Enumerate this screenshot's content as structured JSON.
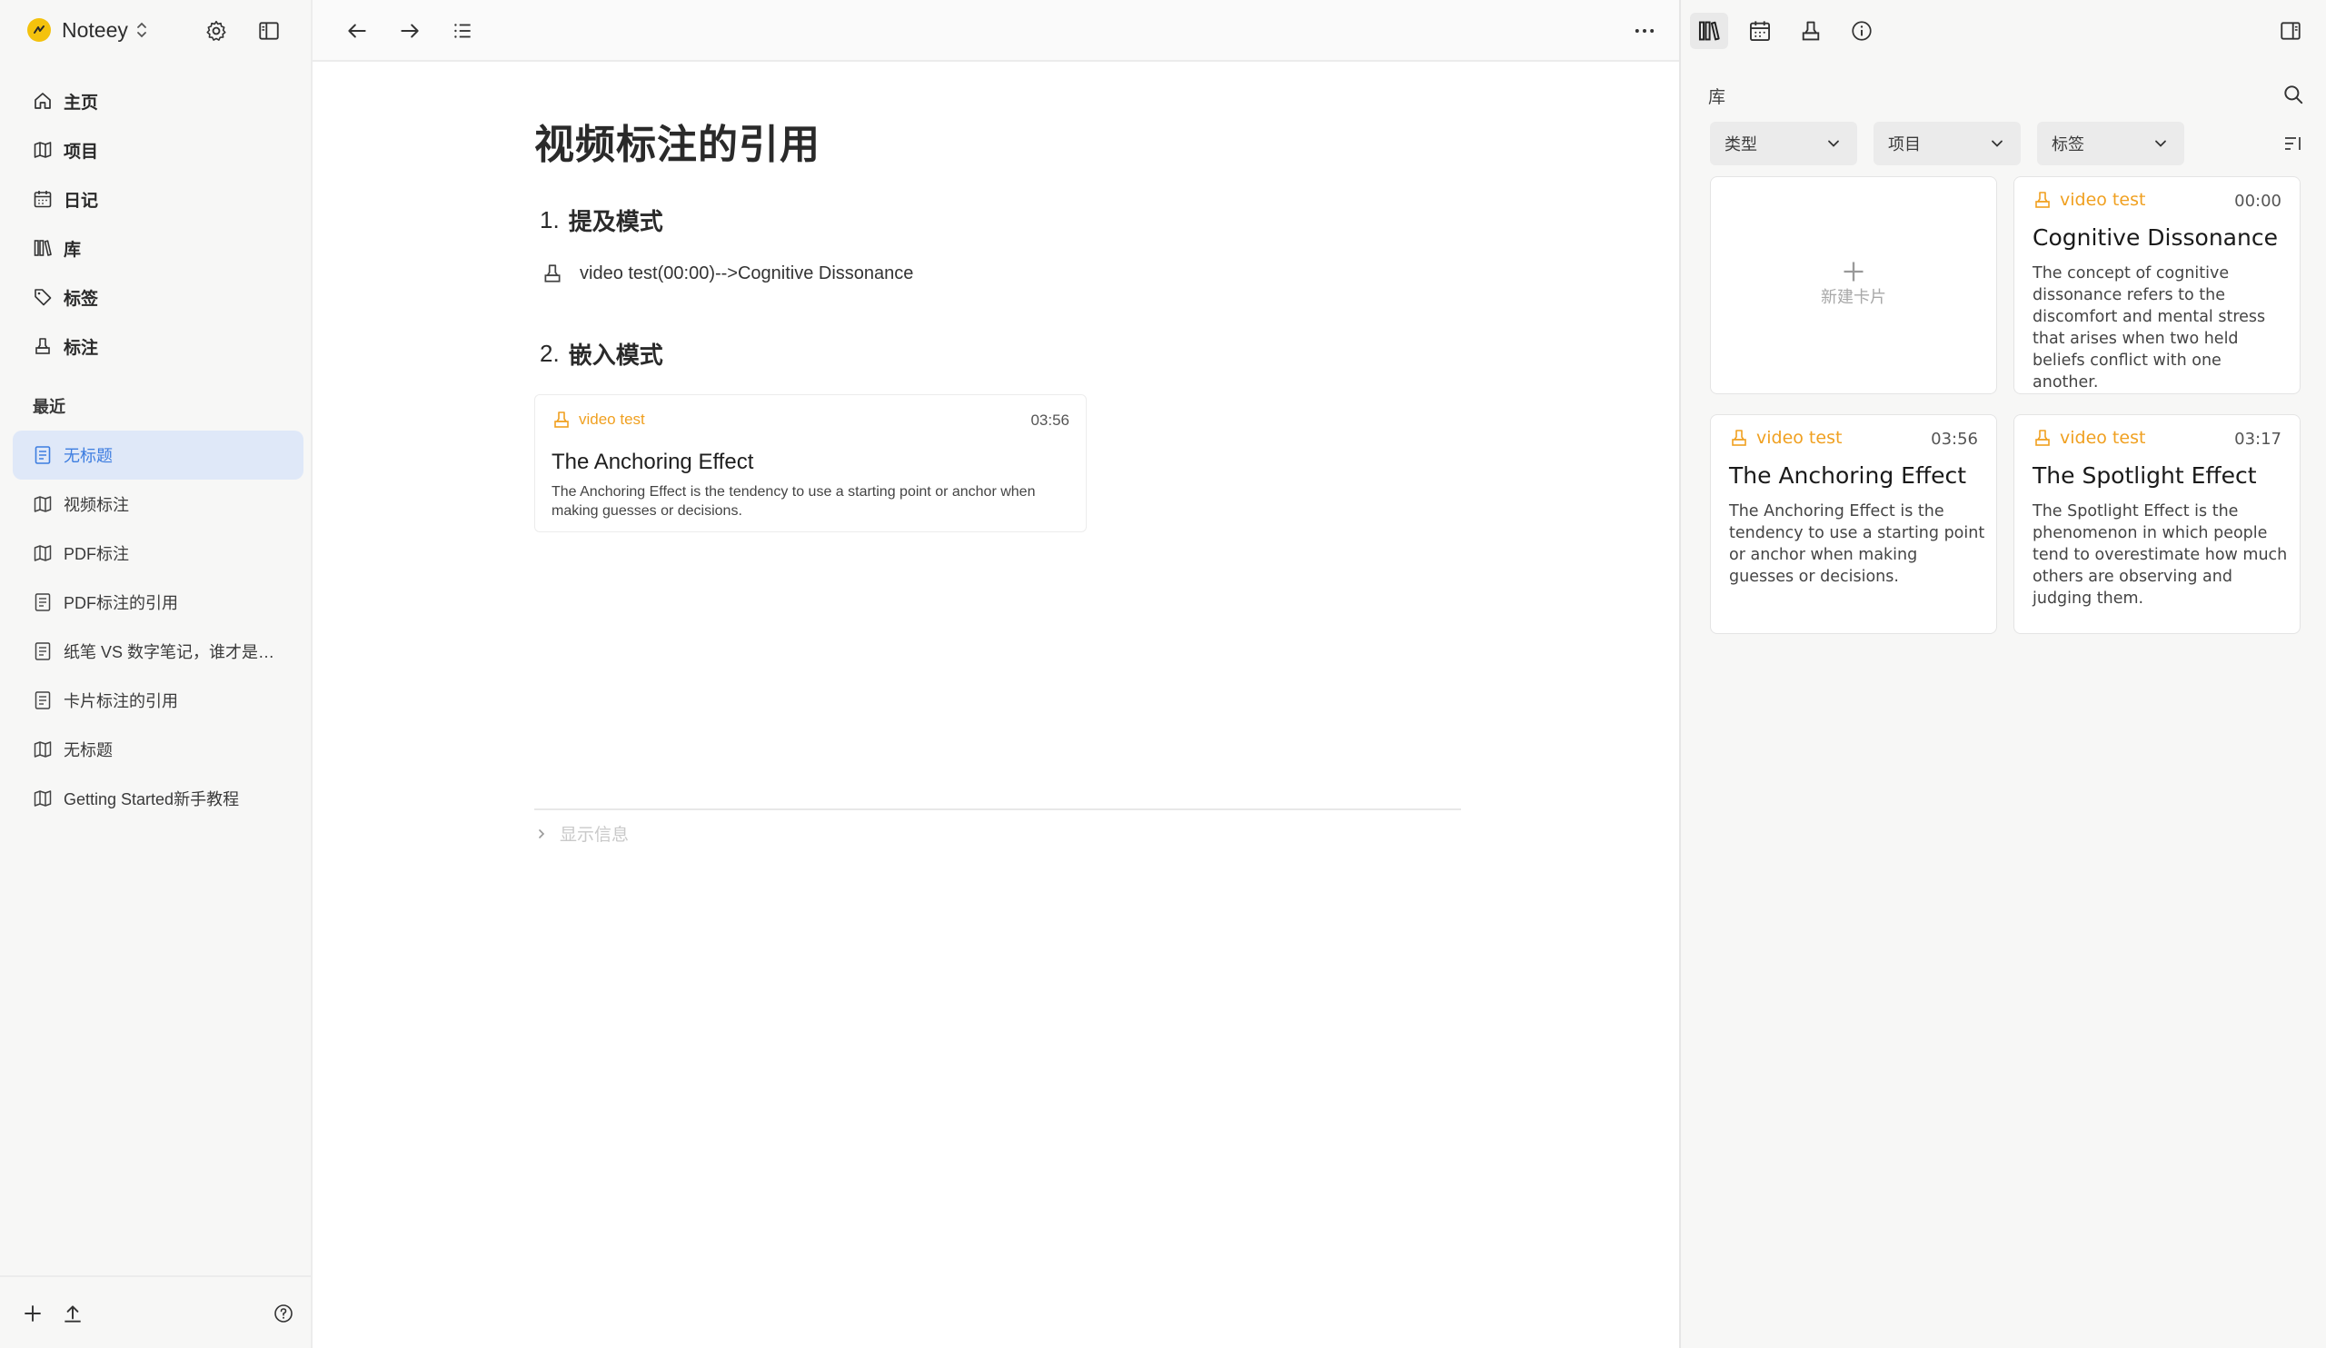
{
  "app": {
    "name": "Noteey"
  },
  "sidebar": {
    "nav": [
      {
        "label": "主页",
        "icon": "home-icon"
      },
      {
        "label": "项目",
        "icon": "map-icon"
      },
      {
        "label": "日记",
        "icon": "calendar-icon"
      },
      {
        "label": "库",
        "icon": "library-icon"
      },
      {
        "label": "标签",
        "icon": "tag-icon"
      },
      {
        "label": "标注",
        "icon": "highlighter-icon"
      }
    ],
    "recent_label": "最近",
    "recent": [
      {
        "label": "无标题",
        "icon": "document-icon",
        "active": true
      },
      {
        "label": "视频标注",
        "icon": "map-icon"
      },
      {
        "label": "PDF标注",
        "icon": "map-icon"
      },
      {
        "label": "PDF标注的引用",
        "icon": "document-icon"
      },
      {
        "label": "纸笔 VS 数字笔记，谁才是最佳选择",
        "icon": "document-icon"
      },
      {
        "label": "卡片标注的引用",
        "icon": "document-icon"
      },
      {
        "label": "无标题",
        "icon": "map-icon"
      },
      {
        "label": "Getting Started新手教程",
        "icon": "map-icon"
      }
    ]
  },
  "document": {
    "title": "视频标注的引用",
    "sections": [
      {
        "number": "1.",
        "heading": "提及模式"
      },
      {
        "number": "2.",
        "heading": "嵌入模式"
      }
    ],
    "mention": {
      "text": "video test(00:00)-->Cognitive Dissonance"
    },
    "embed_card": {
      "source": "video test",
      "time": "03:56",
      "title": "The Anchoring Effect",
      "body": "The Anchoring Effect is the tendency to use a starting point or anchor when making guesses or decisions."
    },
    "show_info": "显示信息"
  },
  "right_panel": {
    "section_title": "库",
    "filters": [
      {
        "label": "类型"
      },
      {
        "label": "项目"
      },
      {
        "label": "标签"
      }
    ],
    "new_card_label": "新建卡片",
    "cards": [
      {
        "source": "video test",
        "time": "00:00",
        "title": "Cognitive Dissonance",
        "body": "The concept of cognitive dissonance refers to the discomfort and mental stress that arises when two held beliefs conflict with one another."
      },
      {
        "source": "video test",
        "time": "03:56",
        "title": "The Anchoring Effect",
        "body": "The Anchoring Effect is the tendency to use a starting point or anchor when making guesses or decisions."
      },
      {
        "source": "video test",
        "time": "03:17",
        "title": "The Spotlight Effect",
        "body": "The Spotlight Effect is the phenomenon in which people tend to overestimate how much others are observing and judging them."
      }
    ]
  },
  "colors": {
    "accent_blue": "#3d7de0",
    "active_bg": "#dfe8f8",
    "annotation_orange": "#f0a020",
    "brand_yellow": "#f4c20d"
  }
}
